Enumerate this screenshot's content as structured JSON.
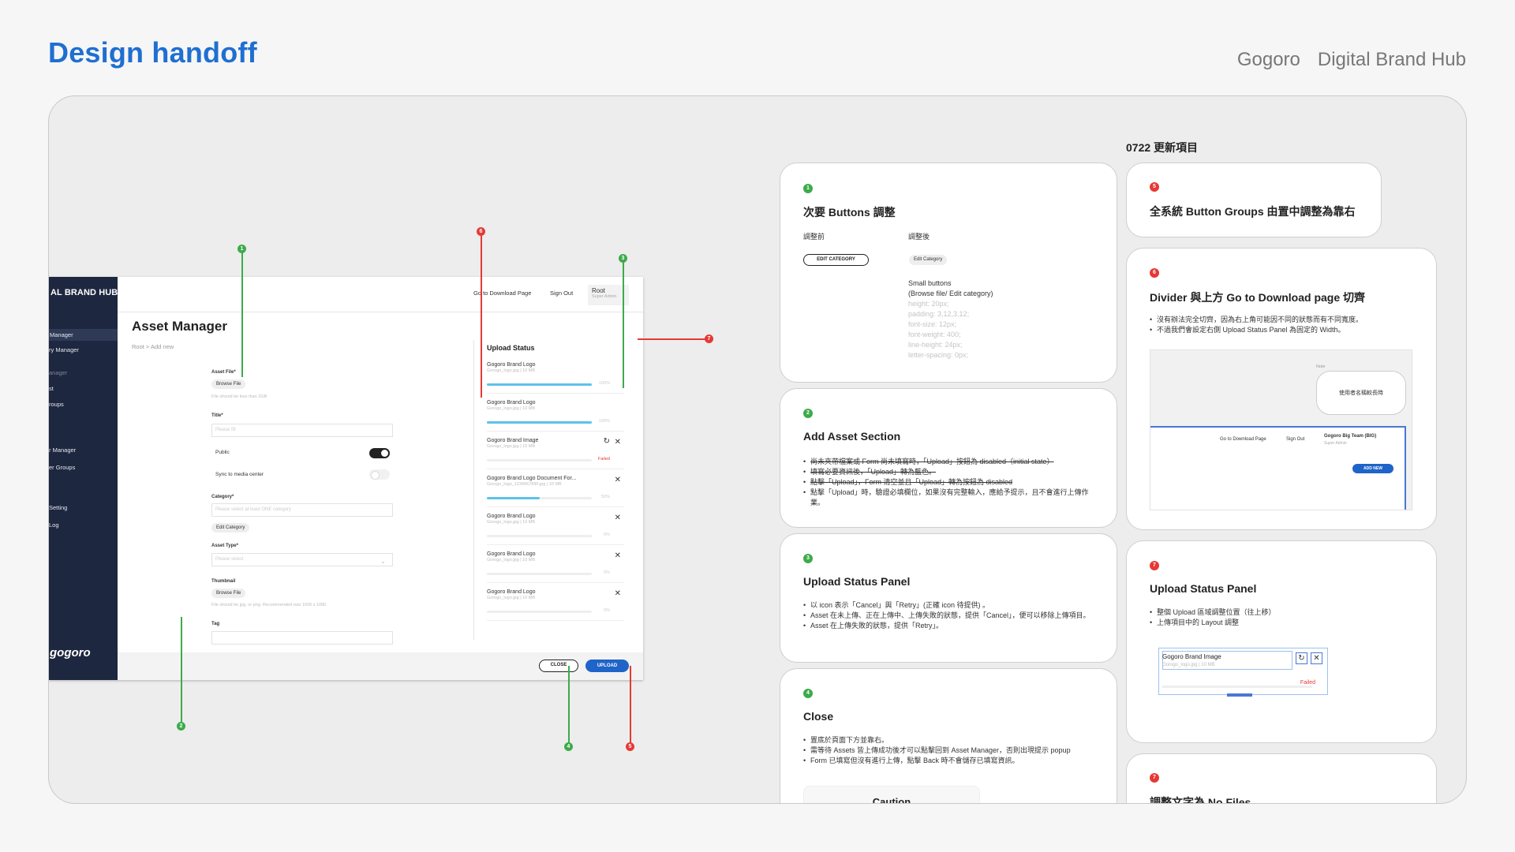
{
  "header": {
    "title": "Design handoff",
    "brand": "Gogoro",
    "product": "Digital Brand Hub"
  },
  "colors": {
    "accent_blue": "#1f6fd1",
    "annot_green": "#3dab4b",
    "annot_red": "#e53935",
    "sidebar_navy": "#1e2740",
    "primary_button": "#1f64c8",
    "progress": "#5ec2ea"
  },
  "mock": {
    "sidebar": {
      "brand": "AL BRAND HUB",
      "items": [
        "Manager",
        "ry Manager",
        "anager",
        "st",
        "roups",
        "r Manager",
        "er Groups",
        "Setting",
        "Log"
      ],
      "logo": "gogoro"
    },
    "topbar": {
      "download": "Go to Download Page",
      "signout": "Sign Out",
      "user_name": "Root",
      "user_role": "Super Admin"
    },
    "page_title": "Asset Manager",
    "breadcrumb": "Root  >  Add new",
    "form": {
      "asset_file_label": "Asset File*",
      "browse_file": "Browse File",
      "asset_file_help": "File should be less than 2GB",
      "title_label": "Title*",
      "title_placeholder": "Please fill",
      "public_label": "Public",
      "sync_label": "Sync to media center",
      "category_label": "Category*",
      "category_placeholder": "Please select at least ONE category",
      "edit_category": "Edit Category",
      "asset_type_label": "Asset Type*",
      "asset_type_placeholder": "Please select",
      "thumbnail_label": "Thumbnail",
      "thumbnail_browse": "Browse File",
      "thumbnail_help": "File should be jpg, or png. Recommended size 1600 x 1080",
      "tag_label": "Tag"
    },
    "upload_status": {
      "title": "Upload Status",
      "items": [
        {
          "name": "Gogoro Brand Logo",
          "meta": "Gorogo_logo.jpg  |  10 MB",
          "pct": "100%",
          "progress": 100,
          "status": "done"
        },
        {
          "name": "Gogoro Brand Logo",
          "meta": "Gorogo_logo.jpg  |  10 MB",
          "pct": "100%",
          "progress": 100,
          "status": "done"
        },
        {
          "name": "Gogoro Brand Image",
          "meta": "Gorogo_logo.jpg  |  10 MB",
          "pct": "Failed",
          "progress": 0,
          "status": "failed"
        },
        {
          "name": "Gogoro Brand Logo Document For...",
          "meta": "Gorogo_logo_1234567890.jpg  |  10 MB",
          "pct": "50%",
          "progress": 50,
          "status": "uploading"
        },
        {
          "name": "Gogoro Brand Logo",
          "meta": "Gorogo_logo.jpg  |  10 MB",
          "pct": "0%",
          "progress": 0,
          "status": "queued"
        },
        {
          "name": "Gogoro Brand Logo",
          "meta": "Gorogo_logo.jpg  |  10 MB",
          "pct": "0%",
          "progress": 0,
          "status": "queued"
        },
        {
          "name": "Gogoro Brand Logo",
          "meta": "Gorogo_logo.jpg  |  10 MB",
          "pct": "0%",
          "progress": 0,
          "status": "queued"
        }
      ]
    },
    "footer": {
      "close": "CLOSE",
      "upload": "UPLOAD"
    }
  },
  "annotations": [
    "1",
    "2",
    "3",
    "4",
    "5",
    "6",
    "7"
  ],
  "updates_title": "0722 更新項目",
  "cards": {
    "c1": {
      "num": "1",
      "title": "次要 Buttons 調整",
      "before_label": "調整前",
      "after_label": "調整後",
      "before_button": "EDIT CATEGORY",
      "after_button": "Edit Category",
      "spec_title": "Small buttons",
      "spec_sub": "(Browse file/ Edit category)",
      "specs": [
        "height: 20px;",
        "padding: 3,12,3,12;",
        "font-size: 12px;",
        "font-weight: 400;",
        "line-height: 24px;",
        "letter-spacing: 0px;"
      ]
    },
    "c2": {
      "num": "2",
      "title": "Add Asset Section",
      "items": [
        {
          "text": "尚未夾帶檔案或 Form 尚未填寫時，「Upload」按鈕為 disabled（initial state）",
          "strike": true
        },
        {
          "text": "填寫必要資訊後，「Upload」轉為藍色。",
          "strike": true
        },
        {
          "text": "點擊「Upload」，Form 清空並且「Upload」轉為按鈕為 disabled",
          "strike": true
        },
        {
          "text": "點擊「Upload」時，驗證必填欄位，如果沒有完整輸入，應給予提示，且不會進行上傳作業。",
          "strike": false
        }
      ]
    },
    "c3": {
      "num": "3",
      "title": "Upload Status Panel",
      "items": [
        {
          "text": "以 icon 表示「Cancel」與「Retry」(正確 icon 待提供) 。",
          "strike": false
        },
        {
          "text": "Asset 在未上傳、正在上傳中、上傳失敗的狀態，提供「Cancel」，便可以移除上傳項目。",
          "strike": false
        },
        {
          "text": "Asset 在上傳失敗的狀態，提供「Retry」。",
          "strike": false
        }
      ]
    },
    "c4": {
      "num": "4",
      "title": "Close",
      "items": [
        {
          "text": "置底於頁面下方並靠右。",
          "strike": false
        },
        {
          "text": "需等待 Assets 皆上傳成功後才可以點擊回到 Asset Manager，否則出現提示 popup",
          "strike": false
        },
        {
          "text": "Form 已填寫但沒有進行上傳，點擊 Back 時不會儲存已填寫資訊。",
          "strike": false
        }
      ],
      "caution": "Caution"
    },
    "c5": {
      "num": "5",
      "title": "全系統 Button Groups 由置中調整為靠右"
    },
    "c6": {
      "num": "6",
      "title": "Divider 與上方 Go to Download page 切齊",
      "items": [
        {
          "text": "沒有辦法完全切齊，因為右上角可能因不同的狀態而有不同寬度。",
          "strike": false
        },
        {
          "text": "不過我們會設定右側 Upload Status Panel 為固定的 Width。",
          "strike": false
        }
      ],
      "shot_note": "Note",
      "shot_bubble": "使用者名稱較長時",
      "shot_download": "Go to Download Page",
      "shot_signout": "Sign Out",
      "shot_user": "Gogoro Big Team (BIG)",
      "shot_role": "Super Admin",
      "shot_add": "ADD NEW"
    },
    "c7": {
      "num": "7",
      "title": "Upload Status Panel",
      "items": [
        {
          "text": "整個 Upload 區域調整位置（往上移）",
          "strike": false
        },
        {
          "text": "上傳項目中的 Layout 調整",
          "strike": false
        }
      ],
      "item_name": "Gogoro Brand Image",
      "item_meta": "Gorogo_logo.jpg  |  10 MB",
      "item_status": "Failed"
    },
    "c8": {
      "num": "7",
      "title": "調整文字為 No Files"
    }
  }
}
